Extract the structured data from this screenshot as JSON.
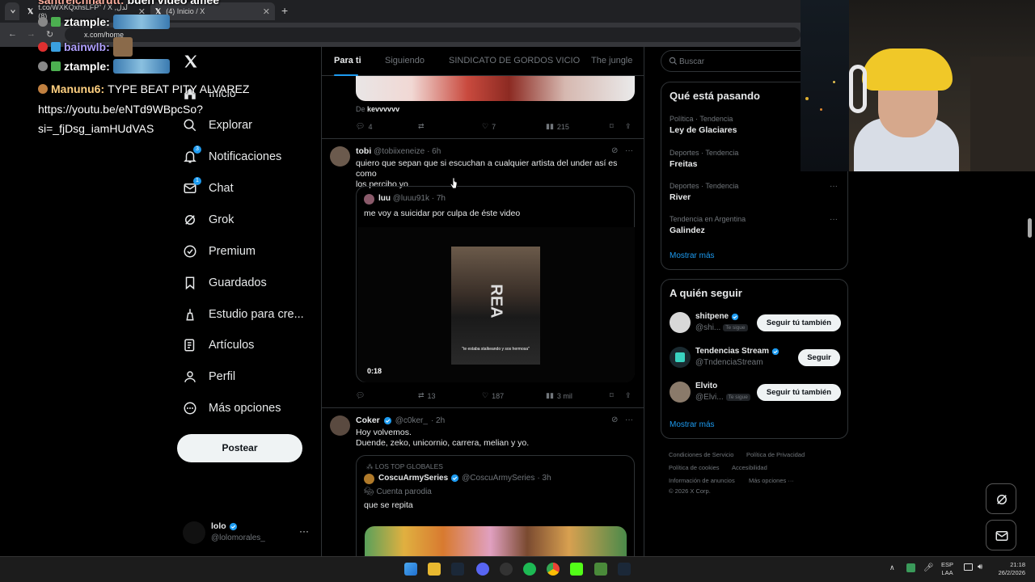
{
  "browser": {
    "tabs": [
      {
        "title": "t.co/WXKQxhsLFP\" / X ,لدل (8)"
      },
      {
        "title": "(4) Inicio / X"
      }
    ],
    "url": "x.com/home"
  },
  "chat_overlay": {
    "lines": [
      {
        "user": "santreichnarutt:",
        "message": "buen video amee"
      },
      {
        "user": "ztample:",
        "message": ""
      },
      {
        "user": "bainwlb:",
        "message": ""
      },
      {
        "user": "ztample:",
        "message": ""
      },
      {
        "user": "Manunu6:",
        "message": "TYPE BEAT PITY ALVAREZ"
      }
    ],
    "link_line1": "https://youtu.be/eNTd9WBpcSo?",
    "link_line2": "si=_fjDsg_iamHUdVAS"
  },
  "sidebar": {
    "items": [
      {
        "label": "Inicio",
        "icon": "home-icon"
      },
      {
        "label": "Explorar",
        "icon": "search-icon"
      },
      {
        "label": "Notificaciones",
        "icon": "bell-icon",
        "badge": "3"
      },
      {
        "label": "Chat",
        "icon": "mail-icon",
        "badge": "1"
      },
      {
        "label": "Grok",
        "icon": "grok-icon"
      },
      {
        "label": "Premium",
        "icon": "verified-icon"
      },
      {
        "label": "Guardados",
        "icon": "bookmark-icon"
      },
      {
        "label": "Estudio para cre...",
        "icon": "studio-icon"
      },
      {
        "label": "Artículos",
        "icon": "article-icon"
      },
      {
        "label": "Perfil",
        "icon": "user-icon"
      },
      {
        "label": "Más opciones",
        "icon": "more-icon"
      }
    ],
    "post_button": "Postear",
    "account": {
      "name": "lolo",
      "handle": "@lolomorales_"
    }
  },
  "feed": {
    "tabs": [
      "Para ti",
      "Siguiendo",
      "SINDICATO DE GORDOS VICIO",
      "The jungle"
    ],
    "tweet0": {
      "from_label": "De",
      "from_user": "kevvvvvv",
      "replies": "4",
      "likes": "7",
      "views": "215"
    },
    "tweet1": {
      "name": "tobi",
      "handle": "@tobiixeneize",
      "time": "· 6h",
      "text_line1": "quiero que sepan que si escuchan a cualquier artista del under así es como",
      "text_line2": "los percibo yo",
      "quote": {
        "name": "luu",
        "handle": "@luuu91k",
        "time": "· 7h",
        "text": "me voy a suicidar por culpa de éste video",
        "video_duration": "0:18",
        "video_caption": "\"te estaba stalkeando y sos hermosa\"",
        "video_shirt": "REA"
      },
      "retweets": "13",
      "likes": "187",
      "views": "3 mil"
    },
    "tweet2": {
      "name": "Coker",
      "handle": "@c0ker_",
      "time": "· 2h",
      "text_line1": "Hoy volvemos.",
      "text_line2": "Duende, zeko, unicornio, carrera, melian y yo.",
      "quote": {
        "community": "LOS TOP GLOBALES",
        "name": "CoscuArmySeries",
        "handle": "@CoscuArmySeries",
        "time": "· 3h",
        "label": "Cuenta parodia",
        "text": "que se repita"
      }
    }
  },
  "right": {
    "search_placeholder": "Buscar",
    "trends_title": "Qué está pasando",
    "trends": [
      {
        "category": "Política · Tendencia",
        "name": "Ley de Glaciares"
      },
      {
        "category": "Deportes · Tendencia",
        "name": "Freitas"
      },
      {
        "category": "Deportes · Tendencia",
        "name": "River"
      },
      {
        "category": "Tendencia en Argentina",
        "name": "Galindez"
      }
    ],
    "show_more": "Mostrar más",
    "follow_title": "A quién seguir",
    "follow": [
      {
        "name": "shitpene",
        "handle": "@shi...",
        "follows_you": "Te sigue",
        "button": "Seguir tú también"
      },
      {
        "name": "Tendencias Stream",
        "handle": "@TndenciaStream",
        "button": "Seguir"
      },
      {
        "name": "Elvito",
        "handle": "@Elvi...",
        "follows_you": "Te sigue",
        "button": "Seguir tú también"
      }
    ],
    "footer": [
      "Condiciones de Servicio",
      "Política de Privacidad",
      "Política de cookies",
      "Accesibilidad",
      "Información de anuncios",
      "Más opciones ···",
      "© 2026 X Corp."
    ]
  },
  "taskbar": {
    "lang1": "ESP",
    "lang2": "LAA",
    "time": "21:18",
    "date": "26/2/2026"
  },
  "colors": {
    "accent": "#1d9bf0",
    "bg": "#000000",
    "border": "#2f3336"
  }
}
